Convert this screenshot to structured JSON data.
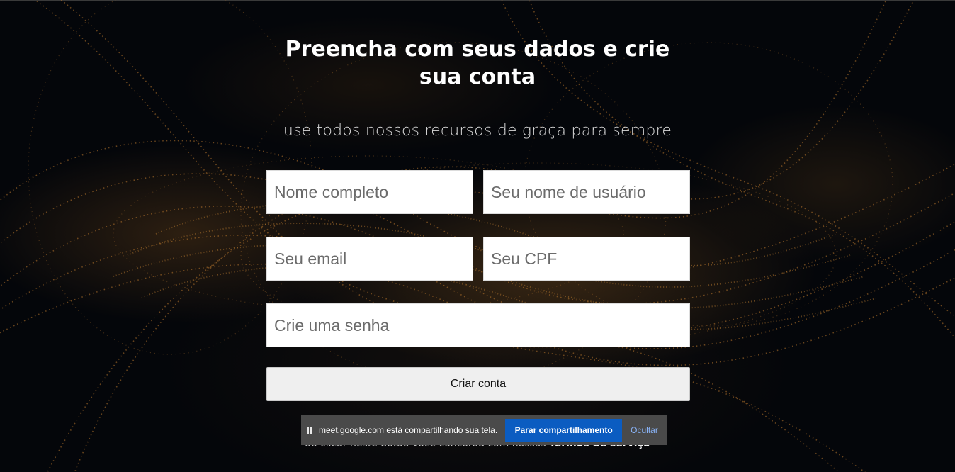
{
  "heading": {
    "title": "Preencha com seus dados e crie sua conta",
    "subtitle": "use todos nossos recursos de graça para sempre"
  },
  "form": {
    "full_name_placeholder": "Nome completo",
    "username_placeholder": "Seu nome de usuário",
    "email_placeholder": "Seu email",
    "cpf_placeholder": "Seu CPF",
    "password_placeholder": "Crie uma senha",
    "submit_label": "Criar conta"
  },
  "terms": {
    "text": "ao clicar neste botão você concorda com nossos",
    "link": "Termos de serviço"
  },
  "share_bar": {
    "message": "meet.google.com está compartilhando sua tela.",
    "stop_label": "Parar compartilhamento",
    "hide_label": "Ocultar"
  },
  "colors": {
    "background": "#04060a",
    "accent_particles": "#b9772d",
    "share_button": "#0b5cc1"
  },
  "icons": {
    "pause": "pause-icon"
  }
}
